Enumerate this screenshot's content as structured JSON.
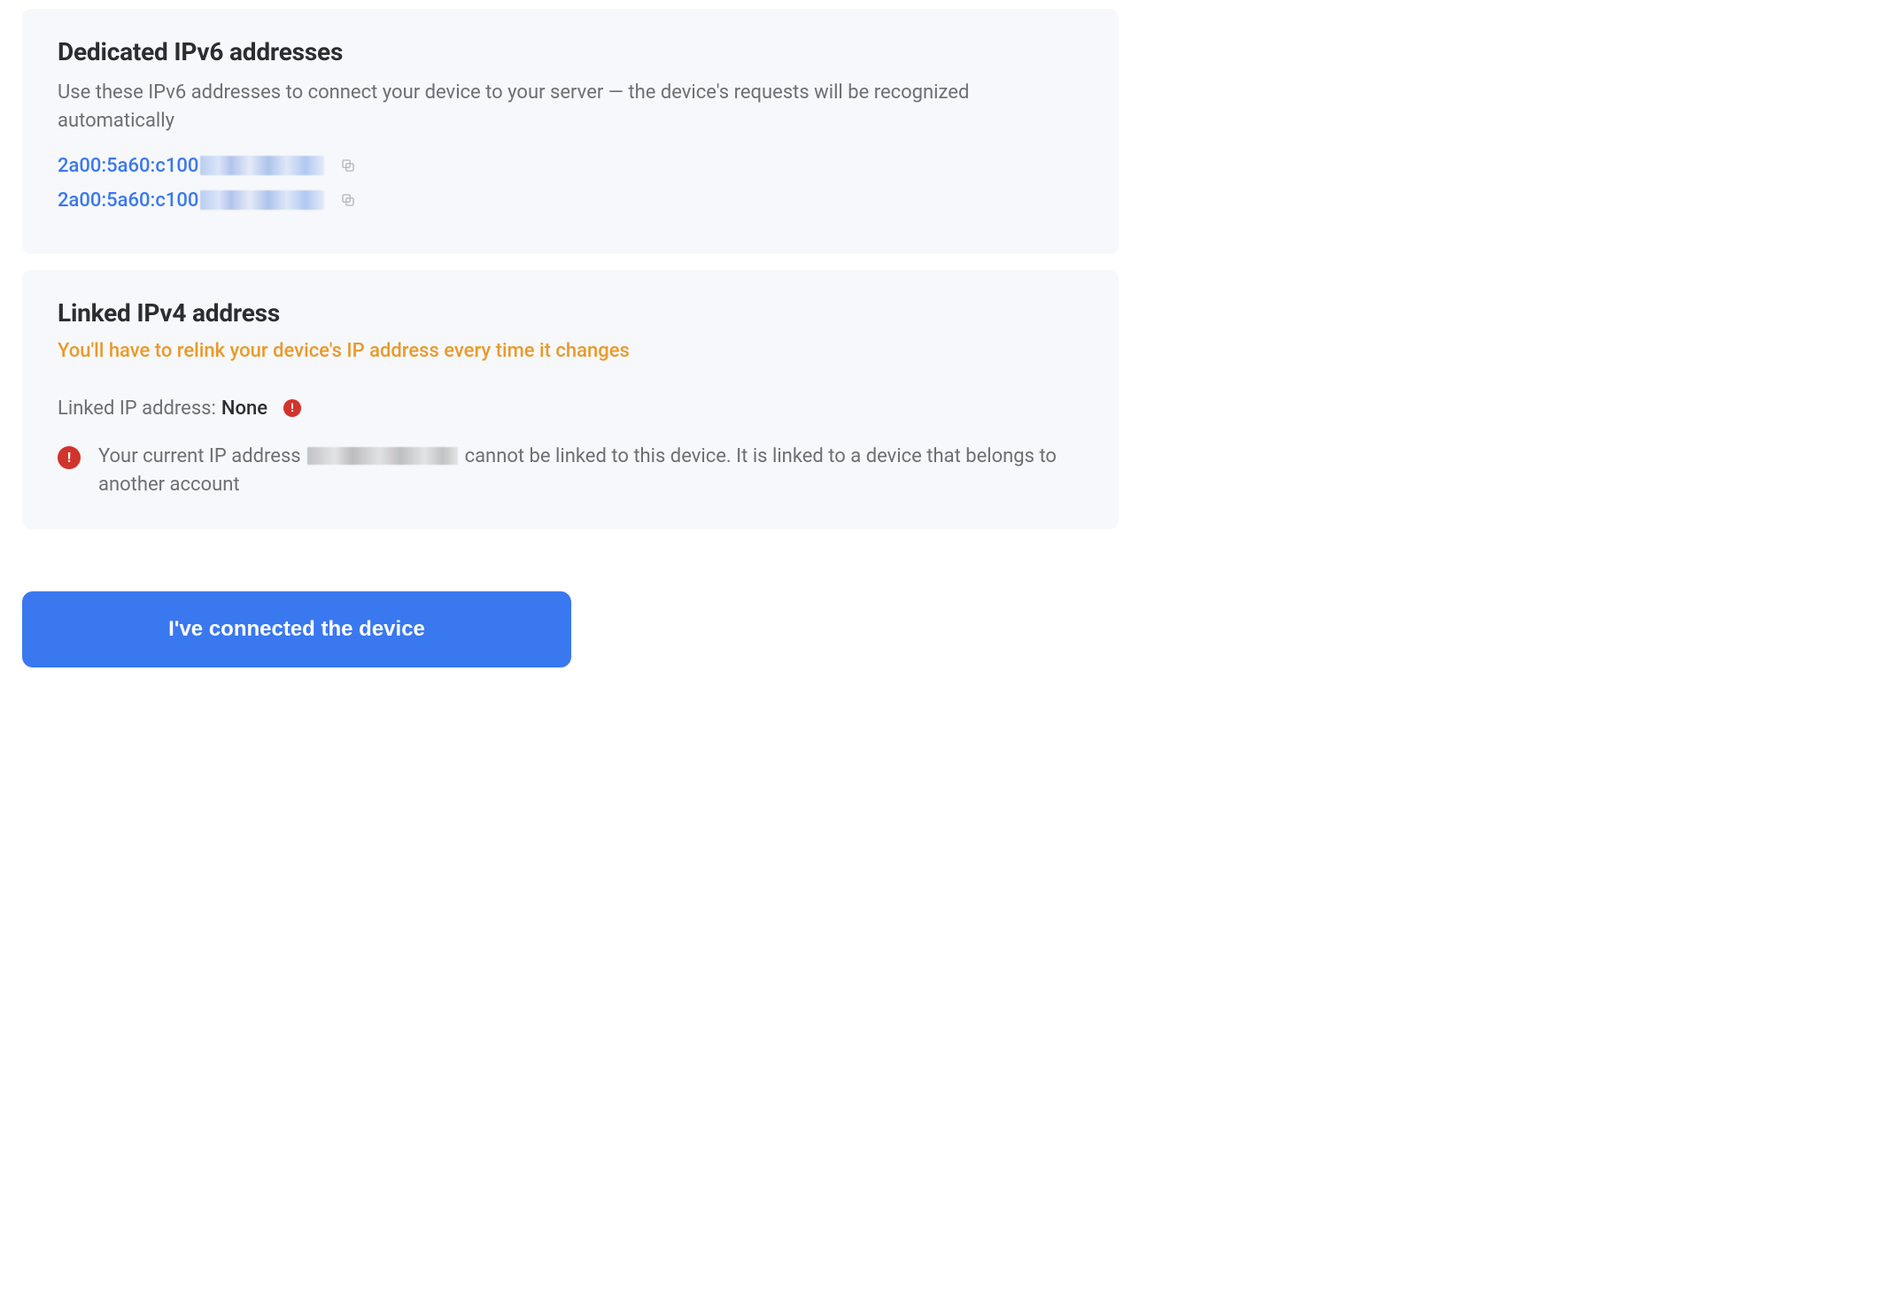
{
  "ipv6": {
    "title": "Dedicated IPv6 addresses",
    "desc": "Use these IPv6 addresses to connect your device to your server — the device's requests will be recognized automatically",
    "addresses": [
      {
        "prefix": "2a00:5a60:c100"
      },
      {
        "prefix": "2a00:5a60:c100"
      }
    ]
  },
  "ipv4": {
    "title": "Linked IPv4 address",
    "warning": "You'll have to relink your device's IP address every time it changes",
    "linked_label": "Linked IP address:",
    "linked_value": "None",
    "error_prefix": "Your current IP address ",
    "error_suffix": " cannot be linked to this device. It is linked to a device that belongs to another account"
  },
  "action": {
    "connected_label": "I've connected the device"
  },
  "icons": {
    "copy": "copy-icon",
    "alert": "alert-icon"
  }
}
